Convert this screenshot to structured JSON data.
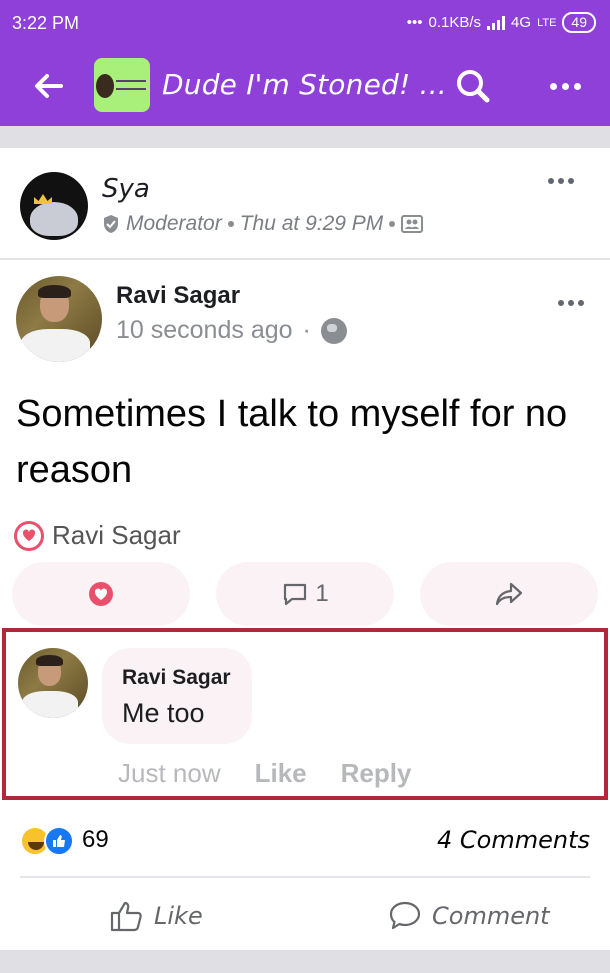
{
  "status_bar": {
    "time": "3:22 PM",
    "network_speed": "0.1KB/s",
    "network_type": "4G",
    "volte": "LTE",
    "battery": "49"
  },
  "toolbar": {
    "title": "Dude I'm Stoned! ...",
    "back_icon": "arrow-left-icon",
    "search_icon": "search-icon",
    "more_icon": "more-dots-icon"
  },
  "post_author": {
    "name": "Sya",
    "role": "Moderator",
    "timestamp": "Thu at 9:29 PM"
  },
  "shared_post": {
    "author": "Ravi Sagar",
    "time": "10 seconds ago",
    "text": "Sometimes I talk to myself for no reason",
    "reactor": "Ravi Sagar",
    "comment_count": "1"
  },
  "comment": {
    "author": "Ravi Sagar",
    "text": "Me too",
    "time": "Just now",
    "like_label": "Like",
    "reply_label": "Reply"
  },
  "summary": {
    "reaction_count": "69",
    "comments_label": "4 Comments"
  },
  "footer": {
    "like_label": "Like",
    "comment_label": "Comment"
  },
  "colors": {
    "brand_purple": "#8e40d8",
    "highlight_red": "#b0283a",
    "love_pink": "#e9506b",
    "like_blue": "#1877f2"
  }
}
